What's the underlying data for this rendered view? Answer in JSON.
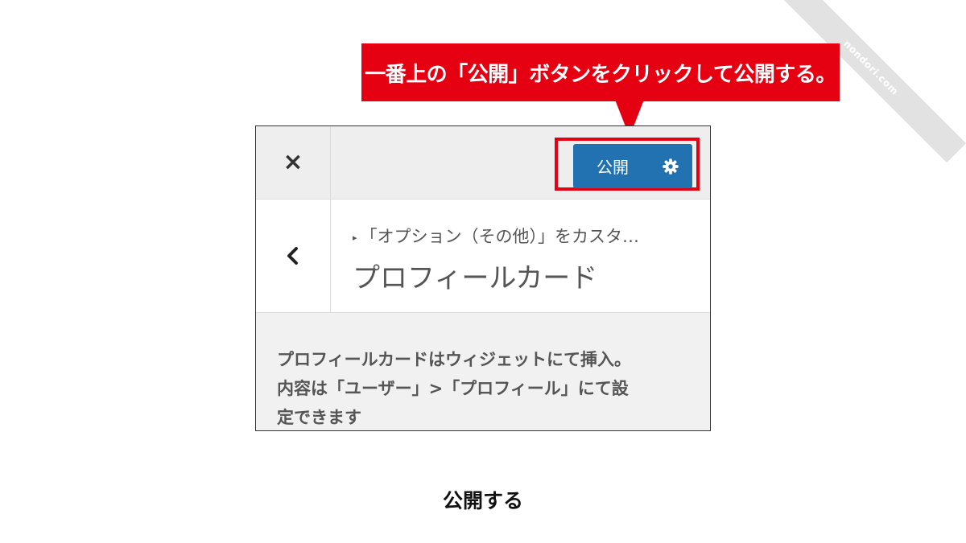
{
  "watermark": "nondori.com",
  "callout": {
    "text": "一番上の「公開」ボタンをクリックして公開する。"
  },
  "toolbar": {
    "close_label": "×",
    "publish_label": "公開",
    "settings_icon": "gear-icon"
  },
  "section": {
    "back_icon": "chevron-left-icon",
    "breadcrumb": "「オプション（その他）」をカスタ…",
    "title": "プロフィールカード"
  },
  "description": {
    "lines": [
      "プロフィールカードはウィジェットにて挿入。",
      "内容は「ユーザー」>「プロフィール」にて設",
      "定できます"
    ]
  },
  "caption": "公開する",
  "colors": {
    "callout_red": "#e50012",
    "publish_blue": "#2271b1",
    "panel_gray": "#f1f1f1"
  }
}
